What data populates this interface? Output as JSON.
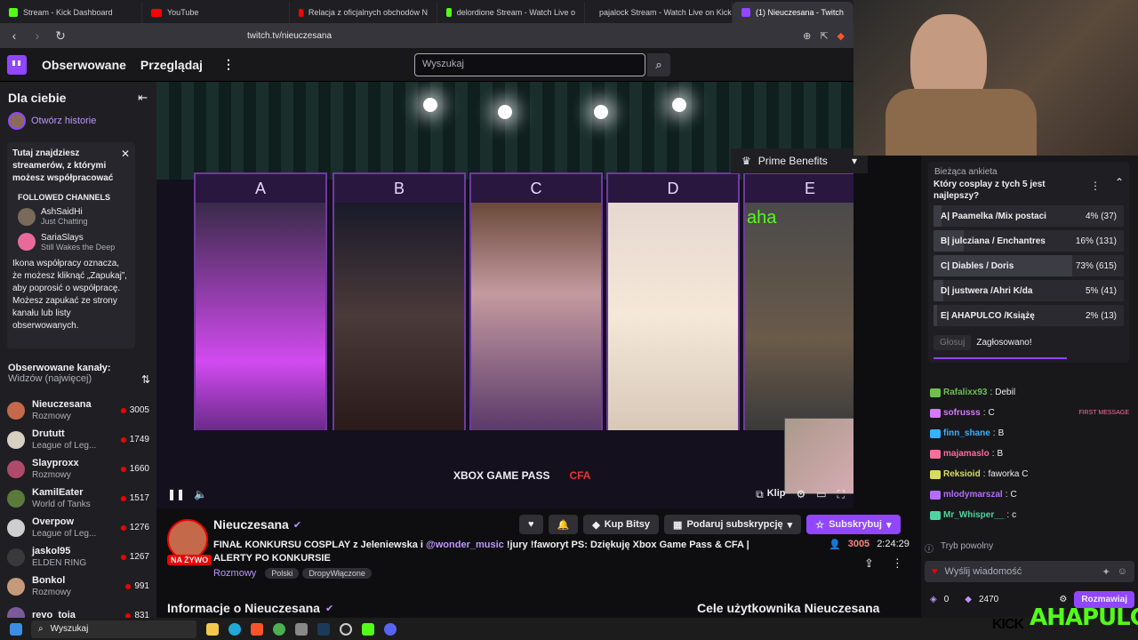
{
  "browser": {
    "tabs": [
      {
        "title": "Stream - Kick Dashboard",
        "icon": "kick-icon"
      },
      {
        "title": "YouTube",
        "icon": "youtube-icon"
      },
      {
        "title": "Relacja z oficjalnych obchodów N",
        "icon": "youtube-icon"
      },
      {
        "title": "delordione Stream - Watch Live o",
        "icon": "kick-icon"
      },
      {
        "title": "pajalock Stream - Watch Live on Kick",
        "icon": "kick-icon"
      },
      {
        "title": "(1) Nieuczesana - Twitch",
        "icon": "twitch-icon"
      }
    ],
    "url": "twitch.tv/nieuczesana"
  },
  "topnav": {
    "followed": "Obserwowane",
    "browse": "Przeglądaj",
    "search_placeholder": "Wyszukaj"
  },
  "sidebar": {
    "for_you": "Dla ciebie",
    "open_stories": "Otwórz historie",
    "popup": {
      "title": "Tutaj znajdziesz streamerów, z którymi możesz współpracować",
      "followed_heading": "FOLLOWED CHANNELS",
      "channels": [
        {
          "name": "AshSaidHi",
          "game": "Just Chatting"
        },
        {
          "name": "SariaSlays",
          "game": "Still Wakes the Deep"
        }
      ],
      "body": "Ikona współpracy oznacza, że możesz kliknąć „Zapukaj”, aby poprosić o współpracę. Możesz zapukać ze strony kanału lub listy obserwowanych."
    },
    "followed_label": "Obserwowane kanały:",
    "sort_label": "Widzów (najwięcej)",
    "channels": [
      {
        "name": "Nieuczesana",
        "game": "Rozmowy",
        "viewers": "3005",
        "color": "#c46a4a"
      },
      {
        "name": "Drututt",
        "game": "League of Leg...",
        "viewers": "1749",
        "color": "#d9d0c4"
      },
      {
        "name": "Slayproxx",
        "game": "Rozmowy",
        "viewers": "1660",
        "color": "#b04a6a"
      },
      {
        "name": "KamilEater",
        "game": "World of Tanks",
        "viewers": "1517",
        "color": "#5a7a3a"
      },
      {
        "name": "Overpow",
        "game": "League of Leg...",
        "viewers": "1276",
        "color": "#cfcfcf"
      },
      {
        "name": "jaskol95",
        "game": "ELDEN RING",
        "viewers": "1267",
        "color": "#3a3a3a"
      },
      {
        "name": "Bonkol",
        "game": "Rozmowy",
        "viewers": "991",
        "color": "#c49a7a"
      },
      {
        "name": "revo_toja",
        "game": "",
        "viewers": "831",
        "color": "#7a5a9a"
      }
    ]
  },
  "video": {
    "panels": [
      "A",
      "B",
      "C",
      "D",
      "E"
    ],
    "prime": "Prime Benefits",
    "sponsors": [
      "XBOX GAME PASS",
      "CFA"
    ],
    "overlay_text": "aha",
    "clip": "Klip"
  },
  "stream": {
    "channel": "Nieuczesana",
    "live_badge": "NA ŻYWO",
    "title_before": "FINAŁ KONKURSU COSPLAY z Jeleniewska i ",
    "mention": "@wonder_music",
    "title_after": " !jury !faworyt PS: Dziękuję Xbox Game Pass & CFA | ALERTY PO KONKURSIE",
    "category": "Rozmowy",
    "tags": [
      "Polski",
      "DropyWłączone"
    ],
    "viewers": "3005",
    "uptime": "2:24:29",
    "buy_bits": "Kup Bitsy",
    "gift_sub": "Podaruj subskrypcję",
    "subscribe": "Subskrybuj",
    "about": "Informacje o Nieuczesana",
    "goals": "Cele użytkownika Nieuczesana"
  },
  "poll": {
    "heading": "Bieżąca ankieta",
    "question": "Który cosplay z tych 5 jest najlepszy?",
    "options": [
      {
        "label": "A| Paamelka /Mix postaci",
        "pct": "4% (37)",
        "fraction": 0.04
      },
      {
        "label": "B| julcziana / Enchantres",
        "pct": "16% (131)",
        "fraction": 0.16
      },
      {
        "label": "C| Diables / Doris",
        "pct": "73% (615)",
        "fraction": 0.73
      },
      {
        "label": "D| justwera /Ahri K/da",
        "pct": "5% (41)",
        "fraction": 0.05
      },
      {
        "label": "E| AHAPULCO /Książę",
        "pct": "2% (13)",
        "fraction": 0.02
      }
    ],
    "vote": "Głosuj",
    "voted": "Zagłosowano!"
  },
  "chat": {
    "messages": [
      {
        "user": "Rafalixx93",
        "text": "Debil",
        "color": "#6fbf4f"
      },
      {
        "user": "sofrusss",
        "text": "C",
        "color": "#d679ff",
        "note": "FIRST MESSAGE"
      },
      {
        "user": "finn_shane",
        "text": "B",
        "color": "#3ab0ff"
      },
      {
        "user": "majamaslo",
        "text": "B",
        "color": "#ff6b9a"
      },
      {
        "user": "Reksioid",
        "text": "faworka C",
        "color": "#d9dd5f"
      },
      {
        "user": "mlodymarszal",
        "text": "C",
        "color": "#b46cff"
      },
      {
        "user": "Mr_Whisper__",
        "text": "c",
        "color": "#4fd4a0"
      }
    ],
    "slow_mode": "Tryb powolny",
    "input_placeholder": "Wyślij wiadomość",
    "points": "0",
    "bits": "2470",
    "chat_button": "Rozmawiaj"
  },
  "taskbar": {
    "search": "Wyszukaj"
  },
  "overlay": {
    "brand": "AHAPULCO",
    "prefix": "KICK"
  }
}
